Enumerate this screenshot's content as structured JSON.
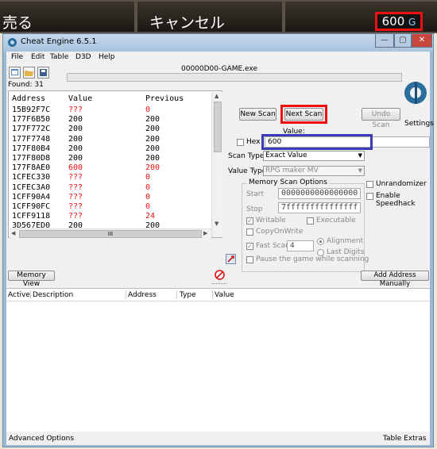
{
  "game": {
    "left_text": "売る",
    "center_text": "キャンセル",
    "gold_value": "600",
    "gold_unit": "G"
  },
  "window": {
    "title": "Cheat Engine 6.5.1",
    "controls": [
      "—",
      "▢",
      "✕"
    ]
  },
  "menu": [
    "File",
    "Edit",
    "Table",
    "D3D",
    "Help"
  ],
  "process_name": "00000D00-GAME.exe",
  "found_label": "Found: 31",
  "scan_list": {
    "headers": [
      "Address",
      "Value",
      "Previous"
    ],
    "rows": [
      {
        "address": "15B92F7C",
        "value": "???",
        "previous": "0"
      },
      {
        "address": "177F6B50",
        "value": "200",
        "previous": "200"
      },
      {
        "address": "177F772C",
        "value": "200",
        "previous": "200"
      },
      {
        "address": "177F7748",
        "value": "200",
        "previous": "200"
      },
      {
        "address": "177F80B4",
        "value": "200",
        "previous": "200"
      },
      {
        "address": "177F80D8",
        "value": "200",
        "previous": "200"
      },
      {
        "address": "177F8AE0",
        "value": "600",
        "previous": "200"
      },
      {
        "address": "1CFEC330",
        "value": "???",
        "previous": "0"
      },
      {
        "address": "1CFEC3A0",
        "value": "???",
        "previous": "0"
      },
      {
        "address": "1CFF90A4",
        "value": "???",
        "previous": "0"
      },
      {
        "address": "1CFF90FC",
        "value": "???",
        "previous": "0"
      },
      {
        "address": "1CFF9118",
        "value": "???",
        "previous": "24"
      },
      {
        "address": "3D567ED0",
        "value": "200",
        "previous": "200"
      }
    ],
    "hscroll_grip": "III"
  },
  "buttons": {
    "new_scan": "New Scan",
    "next_scan": "Next Scan",
    "undo_scan": "Undo Scan",
    "settings": "Settings",
    "memory_view": "Memory View",
    "add_address": "Add Address Manually"
  },
  "value_label": "Value:",
  "hex_label": "Hex",
  "value_input": "600",
  "scan_type": {
    "label": "Scan Type",
    "selected": "Exact Value"
  },
  "value_type": {
    "label": "Value Type",
    "selected": "RPG maker MV"
  },
  "memory_options": {
    "title": "Memory Scan Options",
    "start_label": "Start",
    "start_value": "0000000000000000",
    "stop_label": "Stop",
    "stop_value": "7fffffffffffffff",
    "writable": "Writable",
    "executable": "Executable",
    "copyonwrite": "CopyOnWrite",
    "fast_scan": "Fast Scan",
    "fast_scan_value": "4",
    "alignment": "Alignment",
    "last_digits": "Last Digits",
    "pause": "Pause the game while scanning"
  },
  "unrandomizer": "Unrandomizer",
  "speedhack": "Enable Speedhack",
  "address_list": {
    "headers": [
      "Active",
      "Description",
      "Address",
      "Type",
      "Value"
    ]
  },
  "status": {
    "advanced": "Advanced Options",
    "table_extras": "Table Extras"
  },
  "colors": {
    "red_highlight": "#e11111",
    "blue_highlight": "#3b3bb8",
    "changed_value": "#e11111"
  }
}
